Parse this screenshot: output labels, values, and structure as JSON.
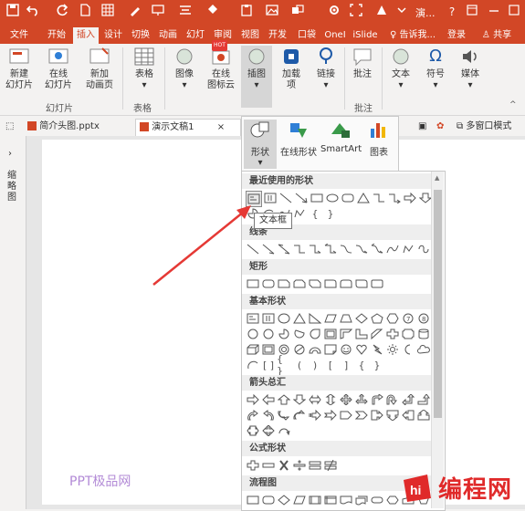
{
  "title_bar": {
    "title": "演...",
    "help": "?"
  },
  "menu_tabs": [
    "文件",
    "开始",
    "插入",
    "设计",
    "切换",
    "动画",
    "幻灯",
    "审阅",
    "视图",
    "开发",
    "口袋",
    "OneI",
    "iSlide"
  ],
  "active_tab": "插入",
  "tell_me": "告诉我...",
  "login": "登录",
  "share": "共享",
  "ribbon": {
    "buttons": [
      {
        "label": "新建\n幻灯片",
        "name": "new-slide-button"
      },
      {
        "label": "在线\n幻灯片",
        "name": "online-slide-button"
      },
      {
        "label": "新加\n动画页",
        "name": "add-anim-page-button"
      },
      {
        "label": "表格",
        "name": "table-button"
      },
      {
        "label": "图像",
        "name": "image-button"
      },
      {
        "label": "在线\n图标云",
        "name": "icon-cloud-button"
      },
      {
        "label": "插图",
        "name": "illustrations-button"
      },
      {
        "label": "加载\n项",
        "name": "addins-button"
      },
      {
        "label": "链接",
        "name": "link-button"
      },
      {
        "label": "批注",
        "name": "comment-button"
      },
      {
        "label": "文本",
        "name": "text-button"
      },
      {
        "label": "符号",
        "name": "symbol-button"
      },
      {
        "label": "媒体",
        "name": "media-button"
      }
    ],
    "groups": [
      "幻灯片",
      "表格",
      "批注"
    ],
    "hot_badge": "HOT"
  },
  "doc_tabs": [
    {
      "label": "简介头图.pptx"
    },
    {
      "label": "演示文稿1",
      "close": "×"
    }
  ],
  "multi_window": "多窗口模式",
  "left_panel_label": "缩略图",
  "popup": {
    "items": [
      "形状",
      "在线形状",
      "SmartArt",
      "图表"
    ]
  },
  "shapes_panel": {
    "sections": [
      "最近使用的形状",
      "线条",
      "矩形",
      "基本形状",
      "箭头总汇",
      "公式形状",
      "流程图"
    ]
  },
  "tooltip": "文本框",
  "watermark": "PPT极品网",
  "brand": "编程网",
  "colors": {
    "accent": "#d24726",
    "arrow": "#e53935",
    "shape_stroke": "#555555"
  }
}
